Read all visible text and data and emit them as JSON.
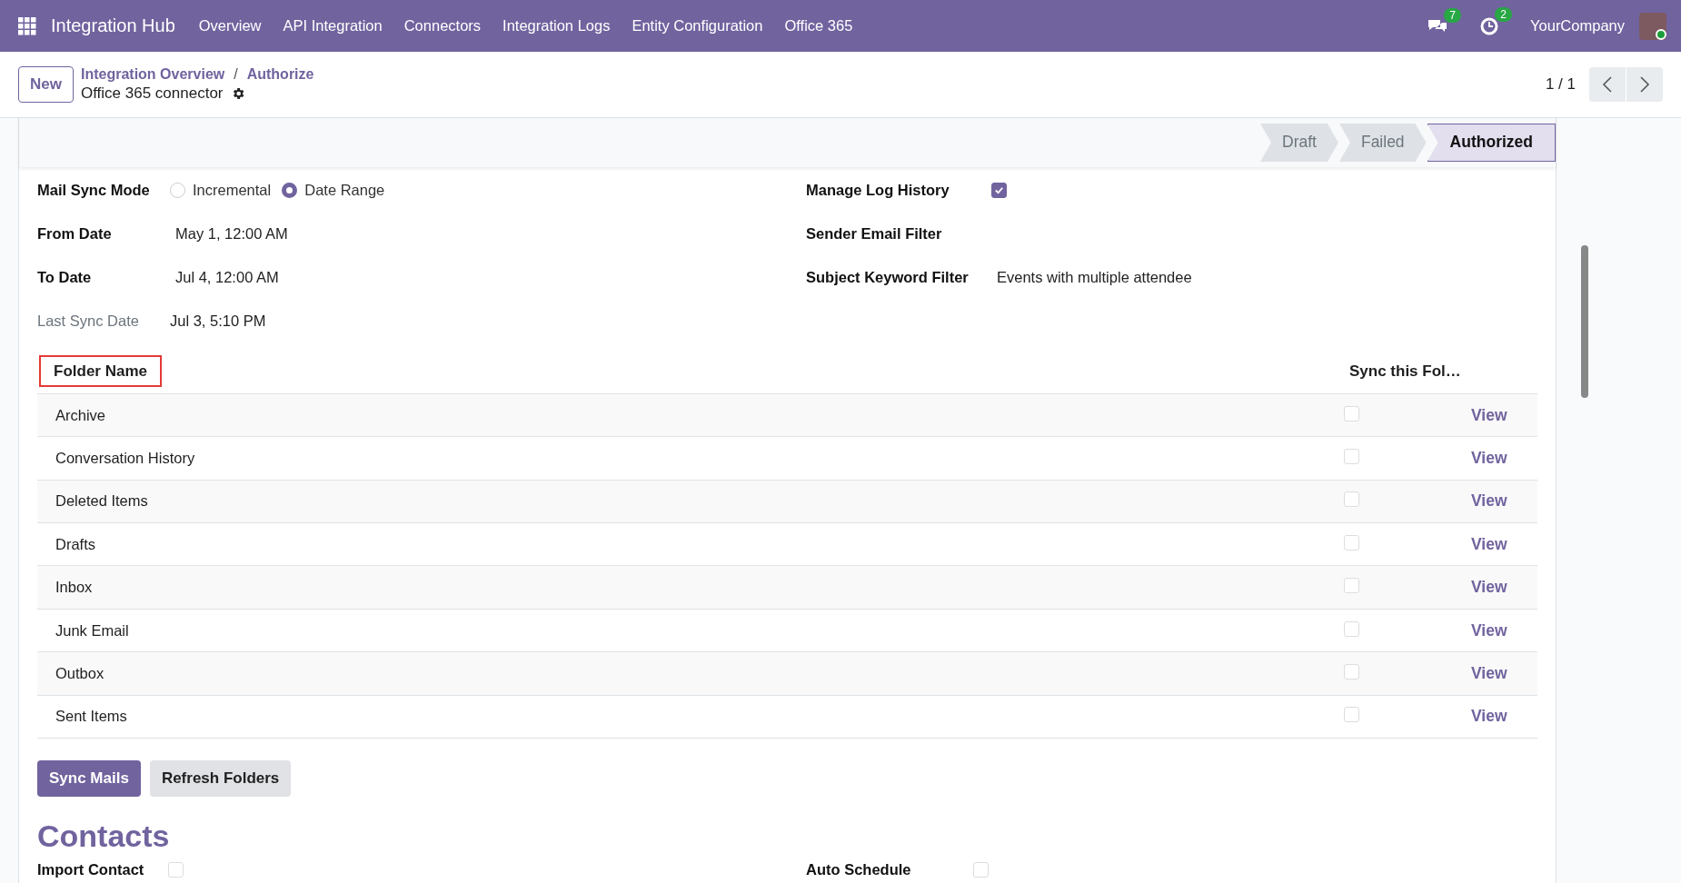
{
  "navbar": {
    "app_name": "Integration Hub",
    "menu": [
      "Overview",
      "API Integration",
      "Connectors",
      "Integration Logs",
      "Entity Configuration",
      "Office 365"
    ],
    "messages_count": "7",
    "activities_count": "2",
    "company": "YourCompany"
  },
  "control_panel": {
    "new_button": "New",
    "breadcrumb": [
      "Integration Overview",
      "Authorize"
    ],
    "breadcrumb_separator": "/",
    "record_title": "Office 365 connector",
    "pager": "1 / 1"
  },
  "status_steps": [
    {
      "label": "Draft",
      "selected": false
    },
    {
      "label": "Failed",
      "selected": false
    },
    {
      "label": "Authorized",
      "selected": true
    }
  ],
  "mail_sync_mode": {
    "label": "Mail Sync Mode",
    "options": [
      {
        "label": "Incremental",
        "selected": false
      },
      {
        "label": "Date Range",
        "selected": true
      }
    ]
  },
  "left_fields": [
    {
      "label": "From Date",
      "value": "May 1, 12:00 AM",
      "readonly": false
    },
    {
      "label": "To Date",
      "value": "Jul 4, 12:00 AM",
      "readonly": false
    },
    {
      "label": "Last Sync Date",
      "value": "Jul 3, 5:10 PM",
      "readonly": true
    }
  ],
  "manage_log_history": {
    "label": "Manage Log History",
    "checked": true
  },
  "right_fields": [
    {
      "label": "Sender Email Filter"
    },
    {
      "label": "Subject Keyword Filter",
      "value": "Events with multiple attendee"
    }
  ],
  "folders": {
    "columns": [
      {
        "label": "Folder Name",
        "highlighted": true
      },
      {
        "label": "Sync this Fol…",
        "highlighted": false
      }
    ],
    "rows": [
      {
        "name": "Archive",
        "sync": false,
        "action": "View"
      },
      {
        "name": "Conversation History",
        "sync": false,
        "action": "View"
      },
      {
        "name": "Deleted Items",
        "sync": false,
        "action": "View"
      },
      {
        "name": "Drafts",
        "sync": false,
        "action": "View"
      },
      {
        "name": "Inbox",
        "sync": false,
        "action": "View"
      },
      {
        "name": "Junk Email",
        "sync": false,
        "action": "View"
      },
      {
        "name": "Outbox",
        "sync": false,
        "action": "View"
      },
      {
        "name": "Sent Items",
        "sync": false,
        "action": "View"
      }
    ]
  },
  "buttons": [
    {
      "label": "Sync Mails",
      "kind": "primary"
    },
    {
      "label": "Refresh Folders",
      "kind": "secondary"
    }
  ],
  "contacts": {
    "title": "Contacts",
    "fields": [
      {
        "label": "Import Contact",
        "checked": false
      },
      {
        "label": "Auto Schedule",
        "checked": false
      }
    ]
  }
}
